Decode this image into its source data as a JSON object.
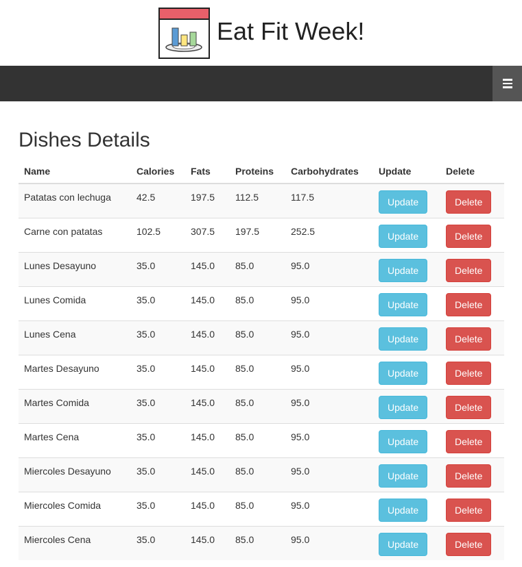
{
  "brand": {
    "title": "Eat Fit Week!",
    "logo_icon": "meal-chart-icon"
  },
  "nav": {
    "menu_icon": "hamburger-icon"
  },
  "page": {
    "title": "Dishes Details"
  },
  "table": {
    "columns": [
      "Name",
      "Calories",
      "Fats",
      "Proteins",
      "Carbohydrates",
      "Update",
      "Delete"
    ],
    "update_label": "Update",
    "delete_label": "Delete",
    "rows": [
      {
        "name": "Patatas con lechuga",
        "calories": "42.5",
        "fats": "197.5",
        "proteins": "112.5",
        "carbohydrates": "117.5"
      },
      {
        "name": "Carne con patatas",
        "calories": "102.5",
        "fats": "307.5",
        "proteins": "197.5",
        "carbohydrates": "252.5"
      },
      {
        "name": "Lunes Desayuno",
        "calories": "35.0",
        "fats": "145.0",
        "proteins": "85.0",
        "carbohydrates": "95.0"
      },
      {
        "name": "Lunes Comida",
        "calories": "35.0",
        "fats": "145.0",
        "proteins": "85.0",
        "carbohydrates": "95.0"
      },
      {
        "name": "Lunes Cena",
        "calories": "35.0",
        "fats": "145.0",
        "proteins": "85.0",
        "carbohydrates": "95.0"
      },
      {
        "name": "Martes Desayuno",
        "calories": "35.0",
        "fats": "145.0",
        "proteins": "85.0",
        "carbohydrates": "95.0"
      },
      {
        "name": "Martes Comida",
        "calories": "35.0",
        "fats": "145.0",
        "proteins": "85.0",
        "carbohydrates": "95.0"
      },
      {
        "name": "Martes Cena",
        "calories": "35.0",
        "fats": "145.0",
        "proteins": "85.0",
        "carbohydrates": "95.0"
      },
      {
        "name": "Miercoles Desayuno",
        "calories": "35.0",
        "fats": "145.0",
        "proteins": "85.0",
        "carbohydrates": "95.0"
      },
      {
        "name": "Miercoles Comida",
        "calories": "35.0",
        "fats": "145.0",
        "proteins": "85.0",
        "carbohydrates": "95.0"
      },
      {
        "name": "Miercoles Cena",
        "calories": "35.0",
        "fats": "145.0",
        "proteins": "85.0",
        "carbohydrates": "95.0"
      }
    ]
  },
  "colors": {
    "navbar": "#333333",
    "menu_toggle": "#555555",
    "update_button": "#5bc0de",
    "delete_button": "#d9534f",
    "striped_row": "#f9f9f9"
  }
}
